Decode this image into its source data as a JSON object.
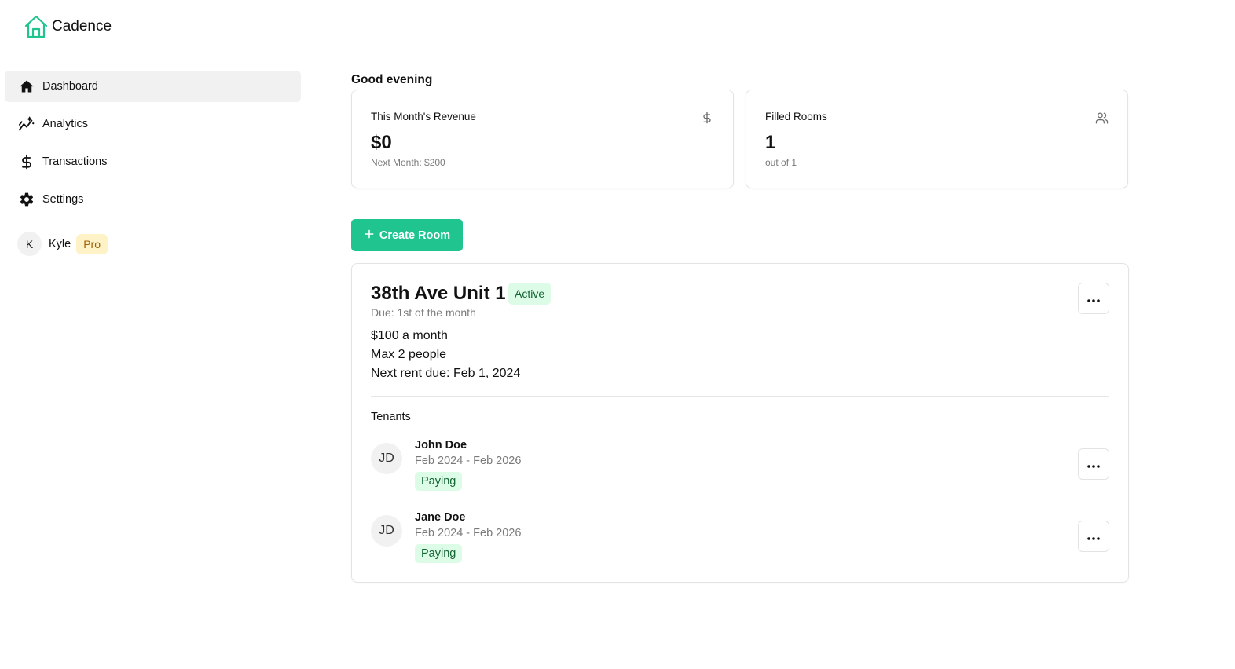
{
  "app": {
    "name": "Cadence",
    "brand_color": "#1fc48e"
  },
  "sidebar": {
    "items": [
      {
        "label": "Dashboard",
        "icon": "home-icon",
        "active": true
      },
      {
        "label": "Analytics",
        "icon": "analytics-icon",
        "active": false
      },
      {
        "label": "Transactions",
        "icon": "dollar-icon",
        "active": false
      },
      {
        "label": "Settings",
        "icon": "gear-icon",
        "active": false
      }
    ],
    "user": {
      "initial": "K",
      "name": "Kyle",
      "plan_badge": "Pro"
    }
  },
  "main": {
    "greeting": "Good evening",
    "stats": {
      "revenue": {
        "title": "This Month's Revenue",
        "value": "$0",
        "sub": "Next Month: $200",
        "icon": "dollar-icon"
      },
      "rooms": {
        "title": "Filled Rooms",
        "value": "1",
        "sub": "out of 1",
        "icon": "users-icon"
      }
    },
    "create_button": {
      "label": "Create Room",
      "icon": "plus-icon"
    },
    "room": {
      "title": "38th Ave Unit 1",
      "status": "Active",
      "due": "Due: 1st of the month",
      "price": "$100 a month",
      "capacity": "Max 2 people",
      "next_due": "Next rent due: Feb 1, 2024",
      "menu_icon": "more-horizontal-icon",
      "tenants_label": "Tenants",
      "tenants": [
        {
          "initials": "JD",
          "name": "John Doe",
          "period": "Feb 2024 - Feb 2026",
          "status": "Paying"
        },
        {
          "initials": "JD",
          "name": "Jane Doe",
          "period": "Feb 2024 - Feb 2026",
          "status": "Paying"
        }
      ]
    }
  }
}
